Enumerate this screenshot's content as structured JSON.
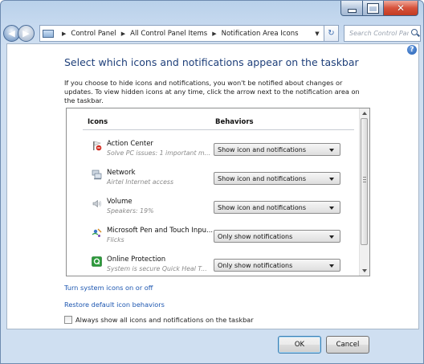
{
  "address": {
    "crumbs": [
      "Control Panel",
      "All Control Panel Items",
      "Notification Area Icons"
    ],
    "search_placeholder": "Search Control Panel"
  },
  "page": {
    "title": "Select which icons and notifications appear on the taskbar",
    "description": "If you choose to hide icons and notifications, you won't be notified about changes or updates. To view hidden icons at any time, click the arrow next to the notification area on the taskbar."
  },
  "table": {
    "col_icons": "Icons",
    "col_behaviors": "Behaviors",
    "rows": [
      {
        "name": "Action Center",
        "sub": "Solve PC issues: 1 important m...",
        "behavior": "Show icon and notifications",
        "icon": "action-center-flag-icon"
      },
      {
        "name": "Network",
        "sub": "Airtel Internet access",
        "behavior": "Show icon and notifications",
        "icon": "network-icon"
      },
      {
        "name": "Volume",
        "sub": "Speakers: 19%",
        "behavior": "Show icon and notifications",
        "icon": "speaker-icon"
      },
      {
        "name": "Microsoft Pen and Touch Inpu...",
        "sub": "Flicks",
        "behavior": "Only show notifications",
        "icon": "pen-touch-icon"
      },
      {
        "name": "Online Protection",
        "sub": "System is secure Quick Heal T...",
        "behavior": "Only show notifications",
        "icon": "quick-heal-icon"
      }
    ]
  },
  "links": {
    "system_icons": "Turn system icons on or off",
    "restore": "Restore default icon behaviors"
  },
  "checkbox": {
    "label": "Always show all icons and notifications on the taskbar",
    "checked": false
  },
  "buttons": {
    "ok": "OK",
    "cancel": "Cancel"
  }
}
